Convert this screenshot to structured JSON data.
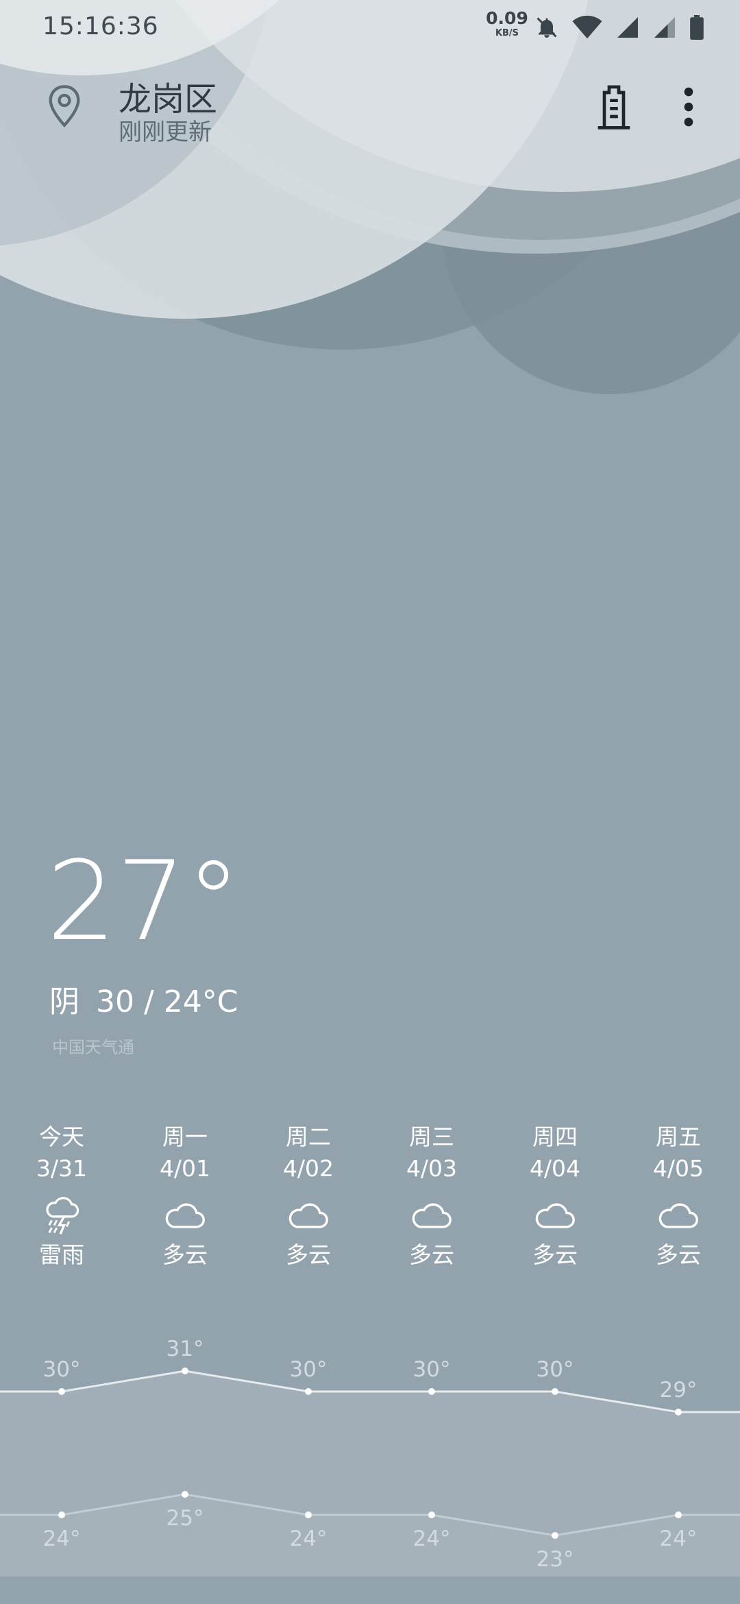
{
  "status_bar": {
    "time": "15:16:36",
    "net_speed_value": "0.09",
    "net_speed_unit": "KB/S",
    "icons": [
      "bell-off-icon",
      "wifi-icon",
      "signal-icon",
      "signal-weak-icon",
      "battery-icon"
    ]
  },
  "header": {
    "city": "龙岗区",
    "updated": "刚刚更新",
    "location_icon": "location-pin-icon",
    "city_manage_icon": "building-icon",
    "more_icon": "more-vertical-icon"
  },
  "current": {
    "temperature": "27°",
    "condition": "阴",
    "range": "30 / 24°C",
    "source": "中国天气通"
  },
  "forecast": [
    {
      "weekday": "今天",
      "date": "3/31",
      "icon": "thunderstorm-icon",
      "condition": "雷雨"
    },
    {
      "weekday": "周一",
      "date": "4/01",
      "icon": "cloud-icon",
      "condition": "多云"
    },
    {
      "weekday": "周二",
      "date": "4/02",
      "icon": "cloud-icon",
      "condition": "多云"
    },
    {
      "weekday": "周三",
      "date": "4/03",
      "icon": "cloud-icon",
      "condition": "多云"
    },
    {
      "weekday": "周四",
      "date": "4/04",
      "icon": "cloud-icon",
      "condition": "多云"
    },
    {
      "weekday": "周五",
      "date": "4/05",
      "icon": "cloud-icon",
      "condition": "多云"
    }
  ],
  "chart_data": {
    "type": "line",
    "series": [
      {
        "name": "",
        "values": [
          30,
          31,
          30,
          30,
          30,
          29
        ],
        "labels": [
          "30°",
          "31°",
          "30°",
          "30°",
          "30°",
          "29°"
        ]
      },
      {
        "name": "",
        "values": [
          24,
          25,
          24,
          24,
          23,
          24
        ],
        "labels": [
          "24°",
          "25°",
          "24°",
          "24°",
          "23°",
          "24°"
        ]
      }
    ]
  },
  "colors": {
    "background": "#93a3ad",
    "text": "#ffffff",
    "header_text": "#2f3a41"
  }
}
